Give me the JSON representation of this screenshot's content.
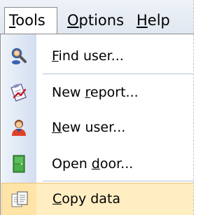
{
  "menubar": {
    "items": [
      {
        "label_underlined": "T",
        "label_rest": "ools"
      },
      {
        "label_underlined": "O",
        "label_rest": "ptions"
      },
      {
        "label_underlined": "H",
        "label_rest": "elp"
      }
    ]
  },
  "dropdown": {
    "items": [
      {
        "icon": "find-user-icon",
        "pre": "",
        "underlined": "F",
        "post": "ind user..."
      },
      {
        "icon": "new-report-icon",
        "pre": "New ",
        "underlined": "r",
        "post": "eport..."
      },
      {
        "icon": "new-user-icon",
        "pre": "",
        "underlined": "N",
        "post": "ew user..."
      },
      {
        "icon": "open-door-icon",
        "pre": "Open ",
        "underlined": "d",
        "post": "oor..."
      },
      {
        "icon": "copy-data-icon",
        "pre": "",
        "underlined": "C",
        "post": "opy data"
      }
    ]
  },
  "colors": {
    "highlight": "#ffeec2",
    "highlight_border": "#e8c57a",
    "gutter": "#d3def0"
  }
}
